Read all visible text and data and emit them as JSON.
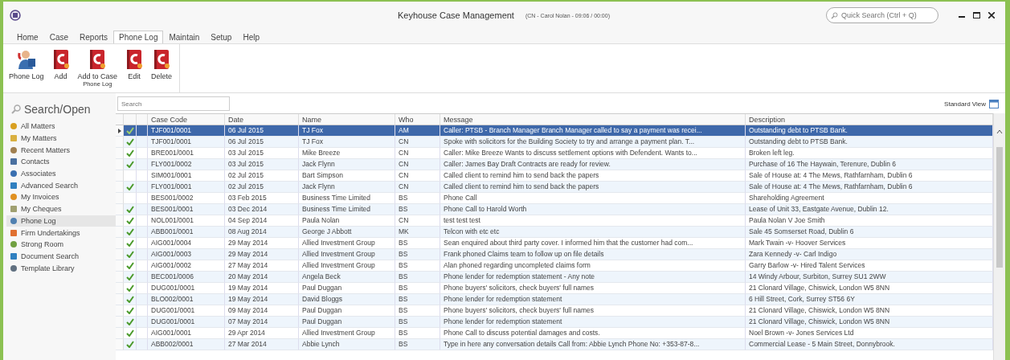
{
  "window": {
    "title": "Keyhouse Case Management",
    "user_info": "(CN - Carol Nolan - 09:06 / 00:00)",
    "quick_search": {
      "placeholder": "Quick Search (Ctrl + Q)"
    }
  },
  "menu_tabs": [
    {
      "label": "Home",
      "selected": false
    },
    {
      "label": "Case",
      "selected": false
    },
    {
      "label": "Reports",
      "selected": false
    },
    {
      "label": "Phone Log",
      "selected": true
    },
    {
      "label": "Maintain",
      "selected": false
    },
    {
      "label": "Setup",
      "selected": false
    },
    {
      "label": "Help",
      "selected": false
    }
  ],
  "ribbon": {
    "buttons": [
      {
        "kind": "person",
        "label": "Phone Log"
      },
      {
        "kind": "book",
        "label": "Add"
      },
      {
        "kind": "book",
        "label": "Add to Case"
      },
      {
        "kind": "book",
        "label": "Edit"
      },
      {
        "kind": "book",
        "label": "Delete"
      }
    ],
    "group_label": "Phone Log"
  },
  "sidebar": {
    "title": "Search/Open",
    "items": [
      {
        "label": "All Matters",
        "selected": false
      },
      {
        "label": "My Matters",
        "selected": false
      },
      {
        "label": "Recent Matters",
        "selected": false
      },
      {
        "label": "Contacts",
        "selected": false
      },
      {
        "label": "Associates",
        "selected": false
      },
      {
        "label": "Advanced Search",
        "selected": false
      },
      {
        "label": "My Invoices",
        "selected": false
      },
      {
        "label": "My Cheques",
        "selected": false
      },
      {
        "label": "Phone Log",
        "selected": true
      },
      {
        "label": "Firm Undertakings",
        "selected": false
      },
      {
        "label": "Strong Room",
        "selected": false
      },
      {
        "label": "Document Search",
        "selected": false
      },
      {
        "label": "Template Library",
        "selected": false
      }
    ]
  },
  "grid": {
    "search": {
      "placeholder": "Search"
    },
    "view_label": "Standard View",
    "columns": [
      "Case Code",
      "Date",
      "Name",
      "Who",
      "Message",
      "Description"
    ],
    "rows": [
      {
        "selected": true,
        "checked": true,
        "cells": [
          "TJF001/0001",
          "06 Jul 2015",
          "TJ Fox",
          "AM",
          "Caller: PTSB - Branch Manager Branch Manager called to say a payment was recei...",
          "Outstanding debt to PTSB Bank."
        ]
      },
      {
        "selected": false,
        "checked": true,
        "cells": [
          "TJF001/0001",
          "06 Jul 2015",
          "TJ Fox",
          "CN",
          "Spoke with solicitors for the Building Society to try and arrange a payment plan. T...",
          "Outstanding debt to PTSB Bank."
        ]
      },
      {
        "selected": false,
        "checked": true,
        "cells": [
          "BRE001/0001",
          "03 Jul 2015",
          "Mike Breeze",
          "CN",
          "Caller: Mike Breeze Wants to discuss settlement options with Defendent. Wants to...",
          "Broken left leg."
        ]
      },
      {
        "selected": false,
        "checked": true,
        "cells": [
          "FLY001/0002",
          "03 Jul 2015",
          "Jack Flynn",
          "CN",
          "Caller: James Bay Draft Contracts are ready for review.",
          "Purchase of 16 The Haywain, Terenure, Dublin 6"
        ]
      },
      {
        "selected": false,
        "checked": false,
        "cells": [
          "SIM001/0001",
          "02 Jul 2015",
          "Bart Simpson",
          "CN",
          "Called client to remind him to send back the papers",
          "Sale of House at: 4 The Mews, Rathfarnham, Dublin 6"
        ]
      },
      {
        "selected": false,
        "checked": true,
        "cells": [
          "FLY001/0001",
          "02 Jul 2015",
          "Jack Flynn",
          "CN",
          "Called client to remind him to send back the papers",
          "Sale of House at:  4 The Mews, Rathfarnham, Dublin 6"
        ]
      },
      {
        "selected": false,
        "checked": false,
        "cells": [
          "BES001/0002",
          "03 Feb 2015",
          "Business Time Limited",
          "BS",
          "Phone Call",
          "Shareholding Agreement"
        ]
      },
      {
        "selected": false,
        "checked": true,
        "cells": [
          "BES001/0001",
          "03 Dec 2014",
          "Business Time Limited",
          "BS",
          "Phone Call to Harold Worth",
          "Lease of Unit 33, Eastgate Avenue, Dublin 12."
        ]
      },
      {
        "selected": false,
        "checked": true,
        "cells": [
          "NOL001/0001",
          "04 Sep 2014",
          "Paula Nolan",
          "CN",
          "test test test",
          "Paula Nolan V Joe Smith"
        ]
      },
      {
        "selected": false,
        "checked": true,
        "cells": [
          "ABB001/0001",
          "08 Aug 2014",
          "George J Abbott",
          "MK",
          "Telcon with etc etc",
          "Sale 45 Somserset Road, Dublin 6"
        ]
      },
      {
        "selected": false,
        "checked": true,
        "cells": [
          "AIG001/0004",
          "29 May 2014",
          "Allied Investment Group",
          "BS",
          "Sean enquired about third party cover. I informed him that the customer had com...",
          "Mark Twain -v- Hoover Services"
        ]
      },
      {
        "selected": false,
        "checked": true,
        "cells": [
          "AIG001/0003",
          "29 May 2014",
          "Allied Investment Group",
          "BS",
          "Frank phoned Claims team to follow up on file details",
          "Zara Kennedy -v- Carl Indigo"
        ]
      },
      {
        "selected": false,
        "checked": true,
        "cells": [
          "AIG001/0002",
          "27 May 2014",
          "Allied Investment Group",
          "BS",
          "Alan phoned regarding uncompleted claims form",
          "Garry Barlow -v- Hired Talent Services"
        ]
      },
      {
        "selected": false,
        "checked": true,
        "cells": [
          "BEC001/0006",
          "20 May 2014",
          "Angela Beck",
          "BS",
          "Phone lender for redemption statement - Any note",
          "14 Windy Arbour, Surbiton, Surrey SU1 2WW"
        ]
      },
      {
        "selected": false,
        "checked": true,
        "cells": [
          "DUG001/0001",
          "19 May 2014",
          "Paul Duggan",
          "BS",
          "Phone buyers' solicitors, check buyers' full names",
          "21 Clonard Village, Chiswick, London W5 8NN"
        ]
      },
      {
        "selected": false,
        "checked": true,
        "cells": [
          "BLO002/0001",
          "19 May 2014",
          "David Bloggs",
          "BS",
          "Phone lender for redemption statement",
          "6 Hill Street, Cork, Surrey ST56 6Y"
        ]
      },
      {
        "selected": false,
        "checked": true,
        "cells": [
          "DUG001/0001",
          "09 May 2014",
          "Paul Duggan",
          "BS",
          "Phone buyers' solicitors, check buyers' full names",
          "21 Clonard Village, Chiswick, London W5 8NN"
        ]
      },
      {
        "selected": false,
        "checked": true,
        "cells": [
          "DUG001/0001",
          "07 May 2014",
          "Paul Duggan",
          "BS",
          "Phone lender for redemption statement",
          "21 Clonard Village, Chiswick, London W5 8NN"
        ]
      },
      {
        "selected": false,
        "checked": true,
        "cells": [
          "AIG001/0001",
          "29 Apr 2014",
          "Allied Investment Group",
          "BS",
          "Phone Call to discuss potential damages and costs.",
          "Noel Brown -v- Jones Services Ltd"
        ]
      },
      {
        "selected": false,
        "checked": true,
        "cells": [
          "ABB002/0001",
          "27 Mar 2014",
          "Abbie Lynch",
          "BS",
          "Type in here any conversation details Call from: Abbie Lynch Phone No: +353-87-8...",
          "Commercial Lease - 5 Main Street, Donnybrook."
        ]
      }
    ]
  }
}
